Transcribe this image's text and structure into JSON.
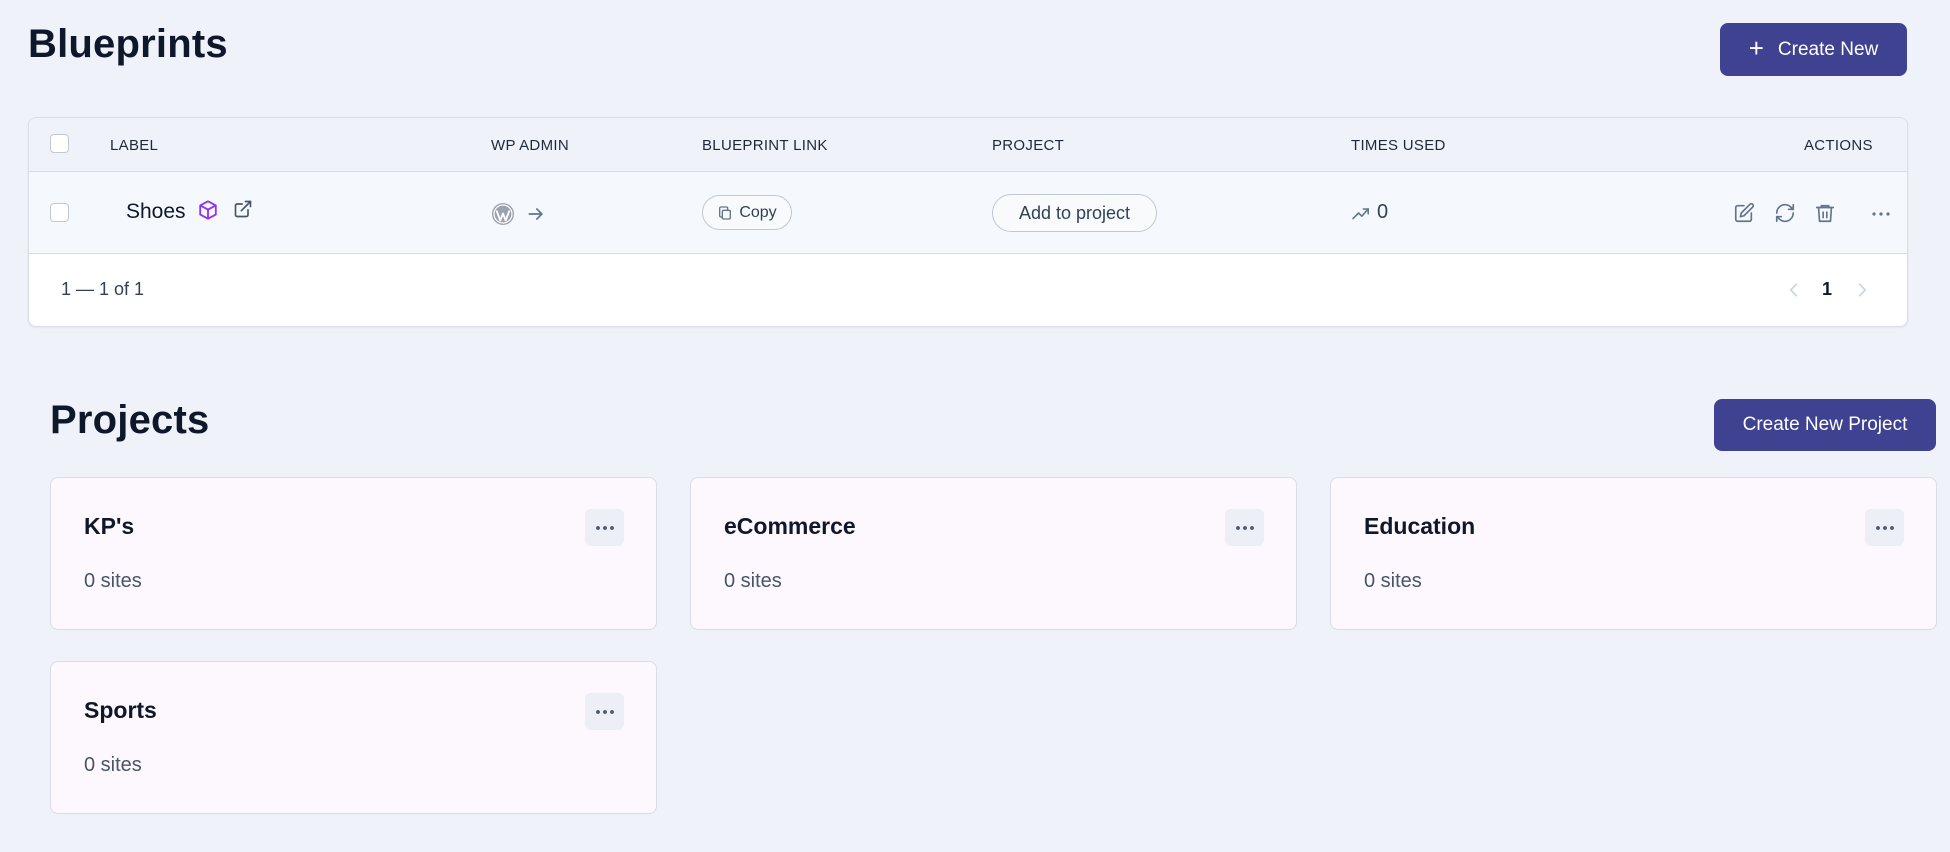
{
  "blueprints": {
    "title": "Blueprints",
    "create_label": "Create New",
    "columns": {
      "label": "LABEL",
      "wp_admin": "WP ADMIN",
      "blueprint_link": "BLUEPRINT LINK",
      "project": "PROJECT",
      "times_used": "TIMES USED",
      "actions": "ACTIONS"
    },
    "rows": [
      {
        "label": "Shoes",
        "link_button": "Copy",
        "project_button": "Add to project",
        "times_used": "0"
      }
    ],
    "pagination": {
      "summary": "1 — 1 of 1",
      "current_page": "1"
    }
  },
  "projects": {
    "title": "Projects",
    "create_label": "Create New Project",
    "items": [
      {
        "name": "KP's",
        "sites": "0 sites"
      },
      {
        "name": "eCommerce",
        "sites": "0 sites"
      },
      {
        "name": "Education",
        "sites": "0 sites"
      },
      {
        "name": "Sports",
        "sites": "0 sites"
      }
    ]
  },
  "colors": {
    "primary": "#3e4291",
    "background": "#eff2f9",
    "blueprint_icon": "#9333ea",
    "card_background": "#fcf8fd"
  },
  "icons": [
    "plus-icon",
    "cube-icon",
    "external-link-icon",
    "wordpress-icon",
    "arrow-right-icon",
    "copy-icon",
    "trending-up-icon",
    "edit-icon",
    "refresh-icon",
    "trash-icon",
    "ellipsis-icon",
    "chevron-left-icon",
    "chevron-right-icon"
  ]
}
